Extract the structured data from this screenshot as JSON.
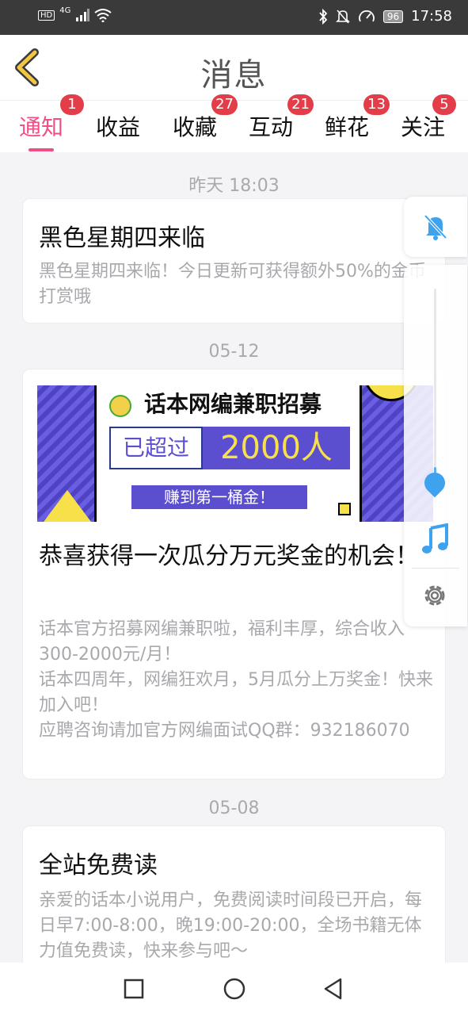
{
  "status_bar": {
    "network_hd": "HD",
    "network_gen": "4G",
    "battery": "96",
    "time": "17:58"
  },
  "header": {
    "title": "消息"
  },
  "tabs": [
    {
      "label": "通知",
      "badge": "1",
      "active": true
    },
    {
      "label": "收益",
      "badge": "",
      "active": false
    },
    {
      "label": "收藏",
      "badge": "27",
      "active": false
    },
    {
      "label": "互动",
      "badge": "21",
      "active": false
    },
    {
      "label": "鲜花",
      "badge": "13",
      "active": false
    },
    {
      "label": "关注",
      "badge": "5",
      "active": false
    }
  ],
  "messages": [
    {
      "date": "昨天 18:03",
      "title": "黑色星期四来临",
      "body": "黑色星期四来临！今日更新可获得额外50%的金币打赏哦"
    },
    {
      "date": "05-12",
      "banner": {
        "headline": "话本网编兼职招募",
        "label_left": "已超过",
        "label_count": "2000人",
        "subline": "赚到第一桶金！"
      },
      "title": "恭喜获得一次瓜分万元奖金的机会！",
      "body_lines": [
        "话本官方招募网编兼职啦，福利丰厚，综合收入300-2000元/月！",
        "话本四周年，网编狂欢月，5月瓜分上万奖金！快来加入吧！",
        "应聘咨询请加官方网编面试QQ群：932186070"
      ]
    },
    {
      "date": "05-08",
      "title": "全站免费读",
      "body": "亲爱的话本小说用户，免费阅读时间段已开启，每日早7:00-8:00，晚19:00-20:00，全场书籍无体力值免费读，快来参与吧～"
    }
  ],
  "floating_panel": {
    "icons": [
      "bell-muted-icon",
      "music-note-icon",
      "gear-icon"
    ],
    "volume_level": 0.1
  },
  "colors": {
    "accent": "#ef4f86",
    "badge": "#e33d4a",
    "back_arrow": "#f2c744",
    "float_icon": "#3ea2ef"
  }
}
